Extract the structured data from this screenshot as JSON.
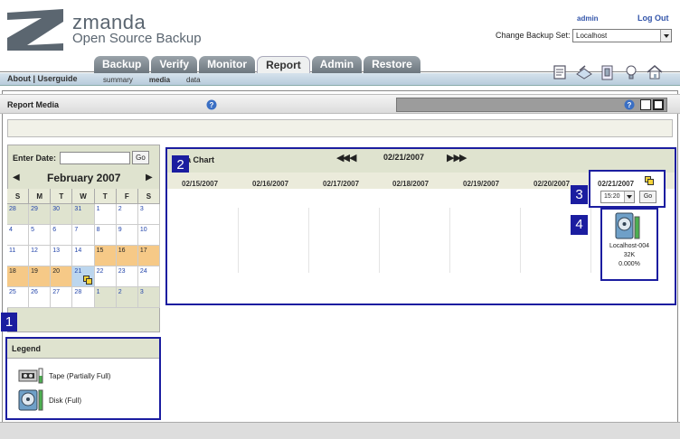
{
  "header": {
    "brand": "zmanda",
    "product": "Open Source Backup",
    "user": "admin",
    "logout": "Log Out",
    "backup_set_label": "Change Backup Set:",
    "backup_set_value": "Localhost"
  },
  "tabs": [
    {
      "label": "Backup"
    },
    {
      "label": "Verify"
    },
    {
      "label": "Monitor"
    },
    {
      "label": "Report",
      "active": true
    },
    {
      "label": "Admin"
    },
    {
      "label": "Restore"
    }
  ],
  "nav_links": "About | Userguide",
  "sub_tabs": [
    {
      "label": "summary"
    },
    {
      "label": "media",
      "current": true
    },
    {
      "label": "data"
    }
  ],
  "toolbar_icons": [
    "reports-icon",
    "backup-icon",
    "folder-icon",
    "help-bulb-icon",
    "home-icon"
  ],
  "section": {
    "title": "Report Media"
  },
  "calendar": {
    "date_label": "Enter Date:",
    "date_value": "",
    "go_label": "Go",
    "month": "February 2007",
    "weekdays": [
      "S",
      "M",
      "T",
      "W",
      "T",
      "F",
      "S"
    ],
    "days": [
      {
        "d": "28",
        "t": "other"
      },
      {
        "d": "29",
        "t": "other"
      },
      {
        "d": "30",
        "t": "other"
      },
      {
        "d": "31",
        "t": "other"
      },
      {
        "d": "1"
      },
      {
        "d": "2"
      },
      {
        "d": "3"
      },
      {
        "d": "4"
      },
      {
        "d": "5"
      },
      {
        "d": "6"
      },
      {
        "d": "7"
      },
      {
        "d": "8"
      },
      {
        "d": "9"
      },
      {
        "d": "10"
      },
      {
        "d": "11"
      },
      {
        "d": "12"
      },
      {
        "d": "13"
      },
      {
        "d": "14"
      },
      {
        "d": "15",
        "t": "mark"
      },
      {
        "d": "16",
        "t": "mark"
      },
      {
        "d": "17",
        "t": "mark"
      },
      {
        "d": "18",
        "t": "mark"
      },
      {
        "d": "19",
        "t": "mark"
      },
      {
        "d": "20",
        "t": "mark"
      },
      {
        "d": "21",
        "t": "sel"
      },
      {
        "d": "22"
      },
      {
        "d": "23"
      },
      {
        "d": "24"
      },
      {
        "d": "25"
      },
      {
        "d": "26"
      },
      {
        "d": "27"
      },
      {
        "d": "28"
      },
      {
        "d": "1",
        "t": "other"
      },
      {
        "d": "2",
        "t": "other"
      },
      {
        "d": "3",
        "t": "other"
      }
    ]
  },
  "legend": {
    "title": "Legend",
    "items": [
      {
        "label": "Tape (Partially Full)",
        "icon": "tape-icon"
      },
      {
        "label": "Disk (Full)",
        "icon": "disk-icon"
      }
    ]
  },
  "chart": {
    "title": "Media Chart",
    "visible_title": "a Chart",
    "nav_date": "02/21/2007",
    "days": [
      "02/15/2007",
      "02/16/2007",
      "02/17/2007",
      "02/18/2007",
      "02/19/2007",
      "02/20/2007"
    ],
    "selected_day": "02/21/2007",
    "time_value": "15:20",
    "go_label": "Go",
    "media": {
      "name": "Localhost-004",
      "size": "32K",
      "percent": "0.000%"
    }
  },
  "callouts": [
    "1",
    "2",
    "3",
    "4"
  ]
}
